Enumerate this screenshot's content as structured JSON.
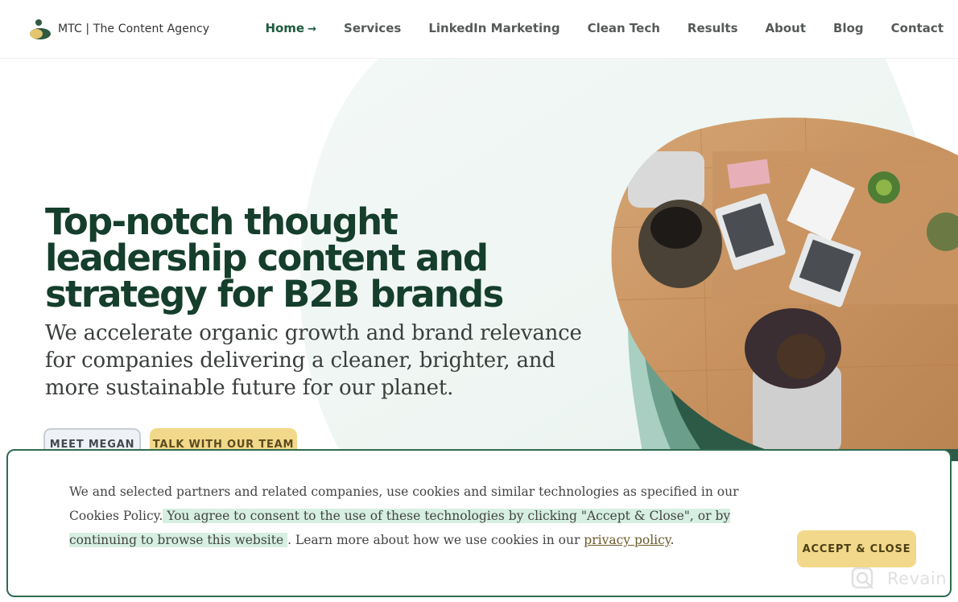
{
  "header": {
    "logo_text": "MTC | The Content Agency",
    "nav": [
      {
        "label": "Home",
        "active": true
      },
      {
        "label": "Services"
      },
      {
        "label": "LinkedIn Marketing"
      },
      {
        "label": "Clean Tech"
      },
      {
        "label": "Results"
      },
      {
        "label": "About"
      },
      {
        "label": "Blog"
      },
      {
        "label": "Contact"
      }
    ],
    "home_arrow": "→"
  },
  "hero": {
    "title": "Top-notch thought leadership content and strategy for B2B brands",
    "subtitle": "We accelerate organic growth and brand relevance for companies delivering a cleaner, brighter, and more sustainable future for our planet.",
    "buttons": {
      "meet": "Meet Megan",
      "talk": "Talk with our team"
    },
    "image_alt_icons": [
      "laptop-icon",
      "plant-icon",
      "people-icon"
    ]
  },
  "cookie": {
    "text_plain_1": "We and selected partners and related companies, use cookies and similar technologies as specified in our Cookies Policy.",
    "text_highlight": " You agree to consent to the use of these technologies by clicking \"Accept & Close\", or by continuing to browse this website ",
    "text_plain_2": ". Learn more about how we use cookies in our ",
    "link_label": "privacy policy",
    "text_end": ".",
    "accept_label": "ACCEPT & CLOSE"
  },
  "watermark": {
    "text": "Revain",
    "icon": "revain-logo-icon"
  },
  "colors": {
    "brand_green": "#153e2c",
    "accent_yellow": "#f2d88a",
    "highlight_mint": "#d6efe2"
  }
}
